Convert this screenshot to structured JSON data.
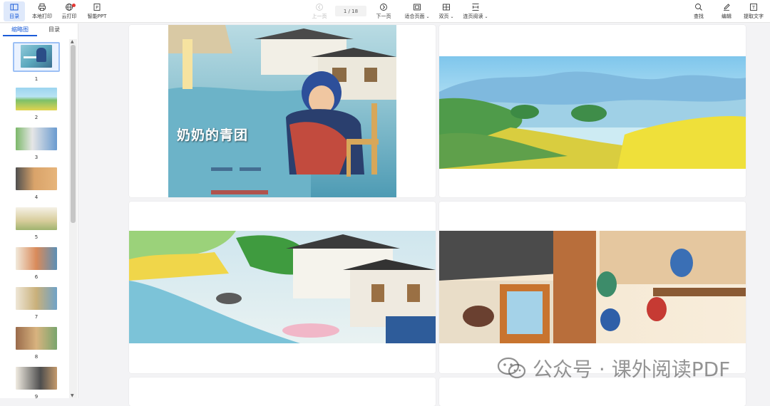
{
  "toolbar": {
    "left_buttons": [
      {
        "label": "目录",
        "icon": "sidebar-toggle-icon",
        "active": true
      },
      {
        "label": "本地打印",
        "icon": "printer-icon"
      },
      {
        "label": "云打印",
        "icon": "cloud-print-icon"
      },
      {
        "label": "智能PPT",
        "icon": "ppt-icon"
      }
    ],
    "prev_label": "上一页",
    "page_indicator": "1 / 18",
    "next_label": "下一页",
    "fit_label": "适合页面",
    "double_label": "双页",
    "continuous_label": "连页阅读",
    "right_buttons": [
      {
        "label": "查找",
        "icon": "search-icon"
      },
      {
        "label": "编辑",
        "icon": "edit-icon"
      },
      {
        "label": "提取文字",
        "icon": "extract-text-icon"
      }
    ]
  },
  "sidebar": {
    "tabs": [
      "缩略图",
      "目录"
    ],
    "active_tab": 0,
    "thumbnails": [
      "1",
      "2",
      "3",
      "4",
      "5",
      "6",
      "7",
      "8",
      "9"
    ]
  },
  "pages": {
    "cover_title": "奶奶的青团"
  },
  "watermark": "公众号 · 课外阅读PDF",
  "colors": {
    "accent": "#1a5bd8",
    "active_bg": "#dfe9fb"
  }
}
